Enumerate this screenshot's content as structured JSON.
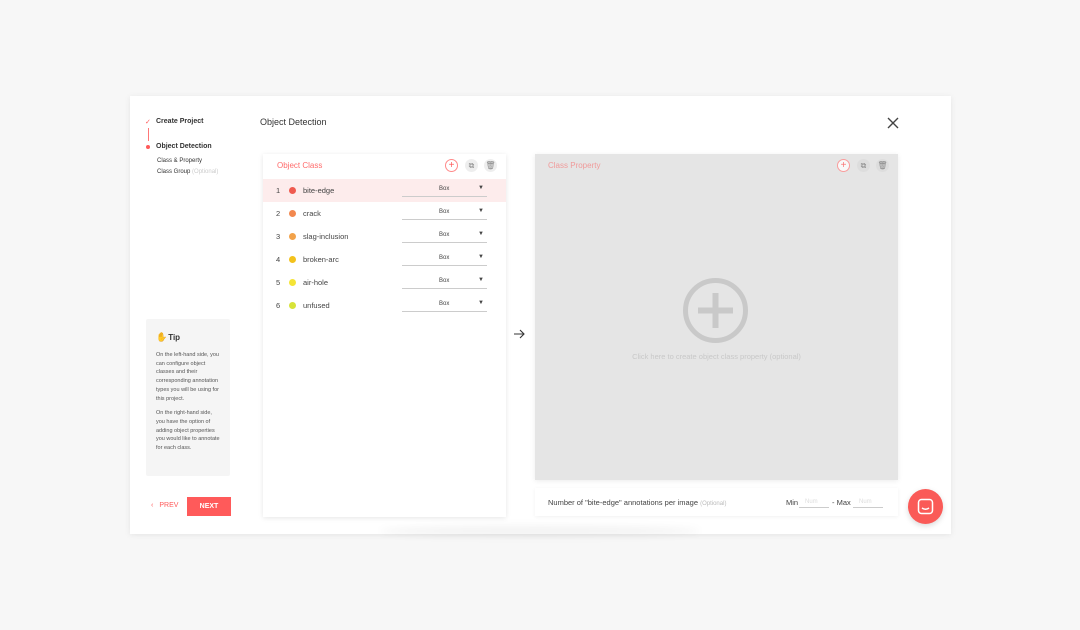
{
  "stepper": {
    "step1": "Create Project",
    "step2": "Object Detection",
    "sub1": "Class & Property",
    "sub2": "Class Group",
    "sub2_optional": "(Optional)"
  },
  "tip": {
    "title": "Tip",
    "p1": "On the left-hand side, you can configure object classes and their corresponding annotation types you will be using for this project.",
    "p2": "On the right-hand side, you have the option of adding object properties you would like to annotate for each class."
  },
  "nav": {
    "prev": "PREV",
    "next": "NEXT"
  },
  "header": {
    "title": "Object Detection"
  },
  "object_class": {
    "title": "Object Class",
    "rows": [
      {
        "num": "1",
        "name": "bite-edge",
        "type": "Box",
        "color": "#ef5a4f"
      },
      {
        "num": "2",
        "name": "crack",
        "type": "Box",
        "color": "#f2884f"
      },
      {
        "num": "3",
        "name": "slag-inclusion",
        "type": "Box",
        "color": "#f2a24a"
      },
      {
        "num": "4",
        "name": "broken-arc",
        "type": "Box",
        "color": "#f3c21c"
      },
      {
        "num": "5",
        "name": "air-hole",
        "type": "Box",
        "color": "#f5e436"
      },
      {
        "num": "6",
        "name": "unfused",
        "type": "Box",
        "color": "#d7e339"
      }
    ]
  },
  "class_property": {
    "title": "Class Property",
    "hint": "Click here to create object class property (optional)"
  },
  "count": {
    "label": "Number of \"bite-edge\" annotations per image",
    "optional": "(Optional)",
    "min_label": "Min",
    "min_placeholder": "Num",
    "max_label": "- Max",
    "max_placeholder": "Num"
  },
  "colors": {
    "accent": "#ff5a5a"
  }
}
